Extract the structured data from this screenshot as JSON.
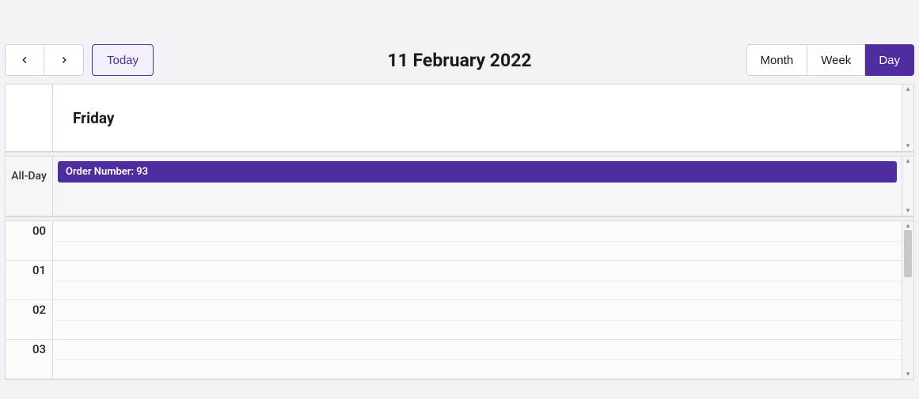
{
  "toolbar": {
    "today_label": "Today",
    "title": "11 February 2022",
    "views": {
      "month": "Month",
      "week": "Week",
      "day": "Day"
    },
    "active_view": "day"
  },
  "calendar": {
    "day_name": "Friday",
    "allday_label": "All-Day",
    "allday_events": [
      {
        "title": "Order Number: 93"
      }
    ],
    "hours": [
      "00",
      "01",
      "02",
      "03"
    ]
  },
  "colors": {
    "accent": "#4f2d9e",
    "background": "#f2f2f7"
  }
}
